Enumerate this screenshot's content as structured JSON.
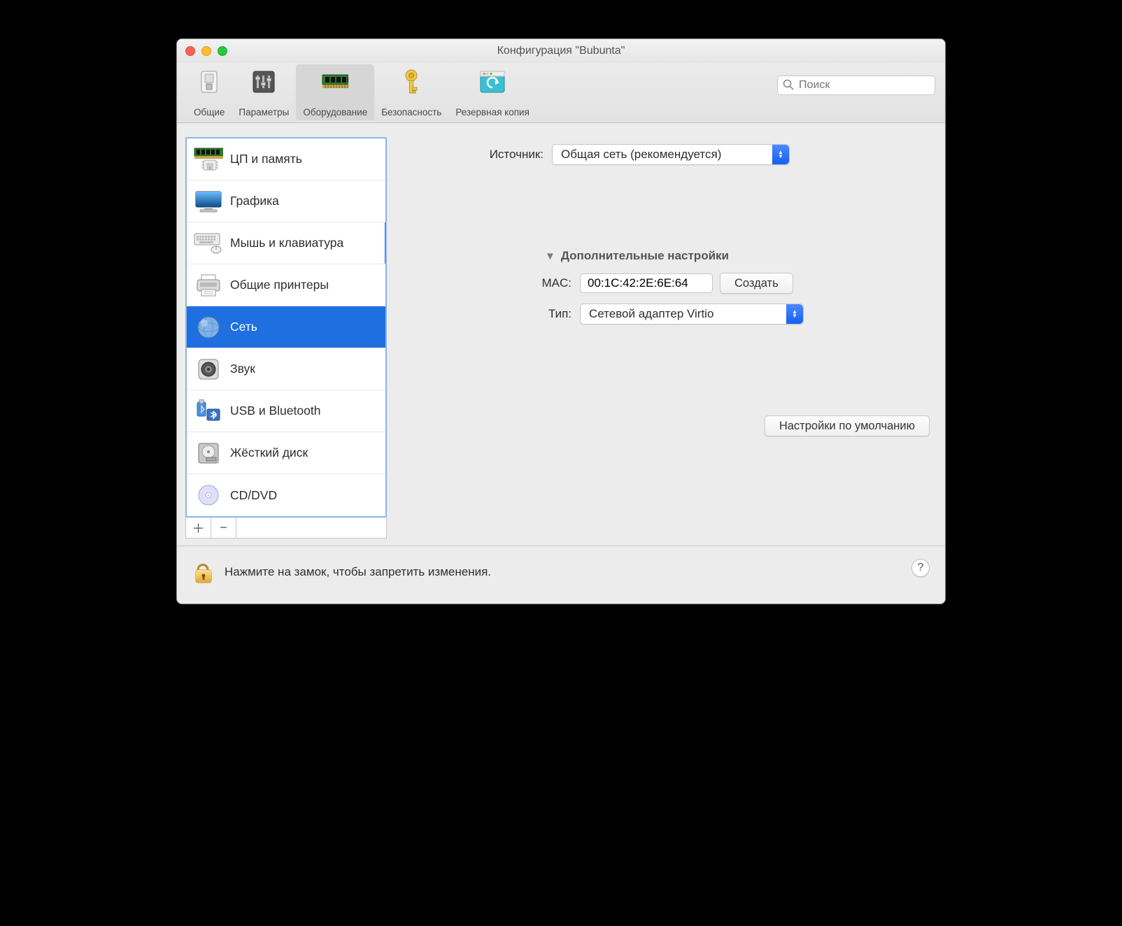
{
  "window": {
    "title": "Конфигурация \"Bubunta\""
  },
  "toolbar": {
    "items": [
      {
        "label": "Общие"
      },
      {
        "label": "Параметры"
      },
      {
        "label": "Оборудование"
      },
      {
        "label": "Безопасность"
      },
      {
        "label": "Резервная копия"
      }
    ],
    "selected_index": 2,
    "search_placeholder": "Поиск"
  },
  "sidebar": {
    "items": [
      {
        "label": "ЦП и память"
      },
      {
        "label": "Графика"
      },
      {
        "label": "Мышь и клавиатура"
      },
      {
        "label": "Общие принтеры"
      },
      {
        "label": "Сеть"
      },
      {
        "label": "Звук"
      },
      {
        "label": "USB и Bluetooth"
      },
      {
        "label": "Жёсткий диск"
      },
      {
        "label": "CD/DVD"
      }
    ],
    "selected_index": 4,
    "marked_index": 2
  },
  "main": {
    "source_label": "Источник:",
    "source_value": "Общая сеть (рекомендуется)",
    "advanced_label": "Дополнительные настройки",
    "mac_label": "MAC:",
    "mac_value": "00:1C:42:2E:6E:64",
    "generate_label": "Создать",
    "type_label": "Тип:",
    "type_value": "Сетевой адаптер Virtio",
    "defaults_label": "Настройки по умолчанию"
  },
  "footer": {
    "lock_text": "Нажмите на замок, чтобы запретить изменения.",
    "help": "?"
  }
}
